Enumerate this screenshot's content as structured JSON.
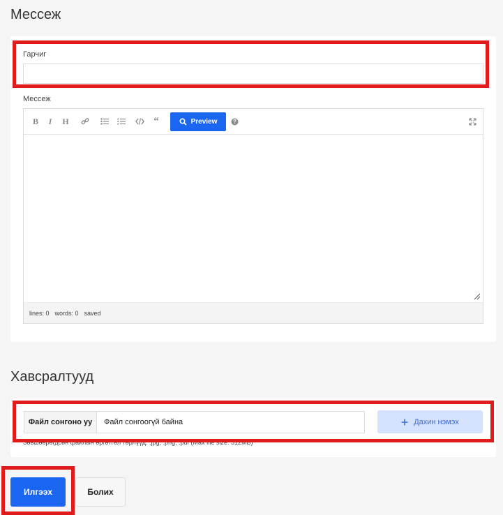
{
  "message_section": {
    "title": "Мессеж",
    "subject_label": "Гарчиг",
    "subject_value": "",
    "body_label": "Мессеж",
    "toolbar": {
      "preview_label": "Preview",
      "icons": [
        "bold-icon",
        "italic-icon",
        "heading-icon",
        "link-icon",
        "unordered-list-icon",
        "ordered-list-icon",
        "code-icon",
        "quote-icon",
        "help-icon",
        "fullscreen-icon"
      ]
    },
    "status": {
      "lines": "lines: 0",
      "words": "words: 0",
      "saved": "saved"
    }
  },
  "attachments_section": {
    "title": "Хавсралтууд",
    "choose_file_label": "Файл сонгоно уу",
    "no_file_text": "Файл сонгоогүй байна",
    "add_more_label": "Дахин нэмэх",
    "hint": "Зөвшөөрөгдсөн файлын өргөтгөл төрлүүд: .jpg, .png, .pdf (Max file size: 512MB)"
  },
  "actions": {
    "submit_label": "Илгээх",
    "cancel_label": "Болих"
  },
  "colors": {
    "accent": "#1a66f0",
    "highlight": "#e01b1b",
    "secondary_button_bg": "#d4e2fd"
  }
}
